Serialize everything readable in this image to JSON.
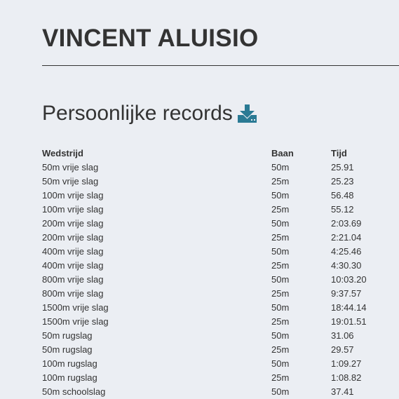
{
  "swimmer": {
    "name": "VINCENT ALUISIO"
  },
  "records_section": {
    "heading": "Persoonlijke records",
    "download_icon": "download-icon",
    "accent_color": "#2a7a94"
  },
  "table": {
    "headers": {
      "event": "Wedstrijd",
      "pool": "Baan",
      "time": "Tijd"
    },
    "rows": [
      {
        "event": "50m vrije slag",
        "pool": "50m",
        "time": "25.91"
      },
      {
        "event": "50m vrije slag",
        "pool": "25m",
        "time": "25.23"
      },
      {
        "event": "100m vrije slag",
        "pool": "50m",
        "time": "56.48"
      },
      {
        "event": "100m vrije slag",
        "pool": "25m",
        "time": "55.12"
      },
      {
        "event": "200m vrije slag",
        "pool": "50m",
        "time": "2:03.69"
      },
      {
        "event": "200m vrije slag",
        "pool": "25m",
        "time": "2:21.04"
      },
      {
        "event": "400m vrije slag",
        "pool": "50m",
        "time": "4:25.46"
      },
      {
        "event": "400m vrije slag",
        "pool": "25m",
        "time": "4:30.30"
      },
      {
        "event": "800m vrije slag",
        "pool": "50m",
        "time": "10:03.20"
      },
      {
        "event": "800m vrije slag",
        "pool": "25m",
        "time": "9:37.57"
      },
      {
        "event": "1500m vrije slag",
        "pool": "50m",
        "time": "18:44.14"
      },
      {
        "event": "1500m vrije slag",
        "pool": "25m",
        "time": "19:01.51"
      },
      {
        "event": "50m rugslag",
        "pool": "50m",
        "time": "31.06"
      },
      {
        "event": "50m rugslag",
        "pool": "25m",
        "time": "29.57"
      },
      {
        "event": "100m rugslag",
        "pool": "50m",
        "time": "1:09.27"
      },
      {
        "event": "100m rugslag",
        "pool": "25m",
        "time": "1:08.82"
      },
      {
        "event": "50m schoolslag",
        "pool": "50m",
        "time": "37.41"
      }
    ]
  }
}
